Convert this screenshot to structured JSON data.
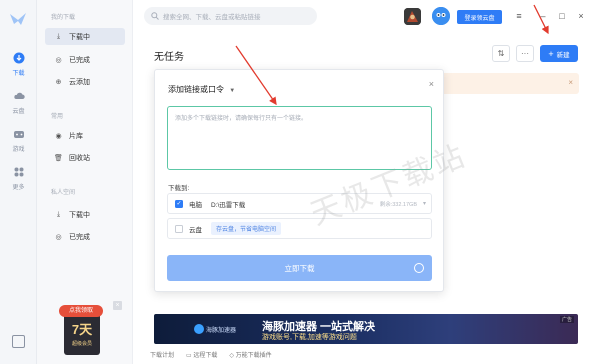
{
  "sidebar": {
    "sections": [
      {
        "title": "我的下载",
        "items": [
          {
            "label": "下载中",
            "icon": "download-icon",
            "active": true
          },
          {
            "label": "已完成",
            "icon": "check-circle-icon",
            "active": false
          },
          {
            "label": "云添加",
            "icon": "cloud-add-icon",
            "active": false
          }
        ]
      },
      {
        "title": "常用",
        "items": [
          {
            "label": "片库",
            "icon": "film-icon",
            "active": false
          },
          {
            "label": "回收站",
            "icon": "trash-icon",
            "active": false
          }
        ]
      },
      {
        "title": "私人空间",
        "items": [
          {
            "label": "下载中",
            "icon": "download-icon",
            "active": false
          },
          {
            "label": "已完成",
            "icon": "check-circle-icon",
            "active": false
          }
        ]
      }
    ],
    "promo": {
      "tag": "点我领取",
      "days": "7天",
      "vip": "超级会员"
    }
  },
  "rail": {
    "items": [
      {
        "label": "下载",
        "icon": "download-circle-icon",
        "active": true
      },
      {
        "label": "云盘",
        "icon": "cloud-icon",
        "active": false
      },
      {
        "label": "游戏",
        "icon": "gamepad-icon",
        "active": false
      },
      {
        "label": "更多",
        "icon": "grid-icon",
        "active": false
      }
    ]
  },
  "topbar": {
    "search_placeholder": "搜索全网、下载、云盘或粘贴链接",
    "cloud_button": "登录领云盘"
  },
  "main": {
    "title": "无任务",
    "new_button": "新建"
  },
  "dialog": {
    "title": "添加链接或口令",
    "textarea_placeholder": "添加多个下载链接时，请确保每行只有一个链接。",
    "download_to_label": "下载到:",
    "local": {
      "name": "电脑",
      "path": "D:\\迅雷下载",
      "space": "剩余:332.17GB"
    },
    "cloud": {
      "name": "云盘",
      "tag": "存云盘，节省电脑空间"
    },
    "submit": "立即下载"
  },
  "banner": {
    "logo_text": "海豚加速器",
    "headline": "海豚加速器 一站式解决",
    "sub": "游戏账号,下载,加速等游戏问题",
    "ad_label": "广告"
  },
  "footer": {
    "links": [
      "下载计划",
      "远程下载",
      "万能下载插件"
    ]
  },
  "watermark": "天极下载站",
  "colors": {
    "accent": "#2e7cf6",
    "focus_border": "#5cc7a6",
    "notice_bg": "#fdf1e6"
  }
}
